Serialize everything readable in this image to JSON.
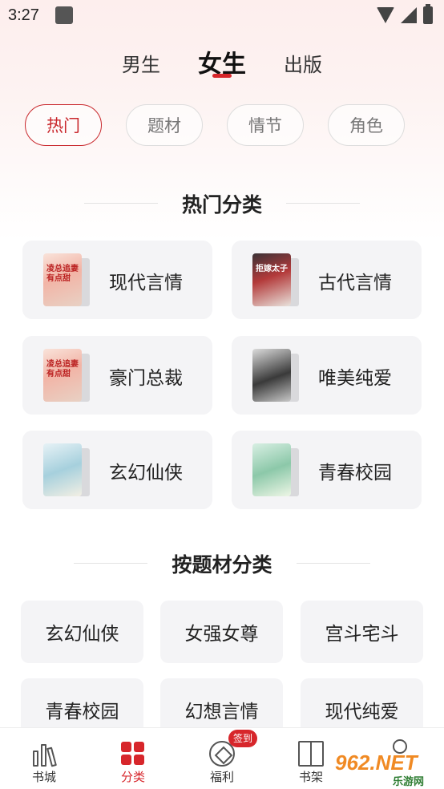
{
  "status_bar": {
    "time": "3:27"
  },
  "top_tabs": [
    {
      "label": "男生"
    },
    {
      "label": "女生",
      "active": true
    },
    {
      "label": "出版"
    }
  ],
  "filter_chips": [
    {
      "label": "热门",
      "active": true
    },
    {
      "label": "题材"
    },
    {
      "label": "情节"
    },
    {
      "label": "角色"
    }
  ],
  "hot_section": {
    "title": "热门分类",
    "items": [
      {
        "label": "现代言情",
        "cover_text": "凌总追妻有点甜"
      },
      {
        "label": "古代言情",
        "cover_text": "拒嫁太子"
      },
      {
        "label": "豪门总裁",
        "cover_text": "凌总追妻有点甜"
      },
      {
        "label": "唯美纯爱",
        "cover_text": ""
      },
      {
        "label": "玄幻仙侠",
        "cover_text": ""
      },
      {
        "label": "青春校园",
        "cover_text": ""
      }
    ]
  },
  "theme_section": {
    "title": "按题材分类",
    "items": [
      {
        "label": "玄幻仙侠"
      },
      {
        "label": "女强女尊"
      },
      {
        "label": "宫斗宅斗"
      },
      {
        "label": "青春校园"
      },
      {
        "label": "幻想言情"
      },
      {
        "label": "现代纯爱"
      }
    ]
  },
  "bottom_nav": [
    {
      "label": "书城",
      "icon": "bookstore-icon"
    },
    {
      "label": "分类",
      "icon": "category-grid-icon",
      "active": true
    },
    {
      "label": "福利",
      "icon": "welfare-icon",
      "badge": "签到"
    },
    {
      "label": "书架",
      "icon": "bookshelf-icon"
    },
    {
      "label": "",
      "icon": "profile-icon"
    }
  ],
  "watermark": {
    "main": "962.NET",
    "sub": "乐游网"
  },
  "colors": {
    "accent": "#d7262b",
    "card_bg": "#f4f4f6"
  }
}
